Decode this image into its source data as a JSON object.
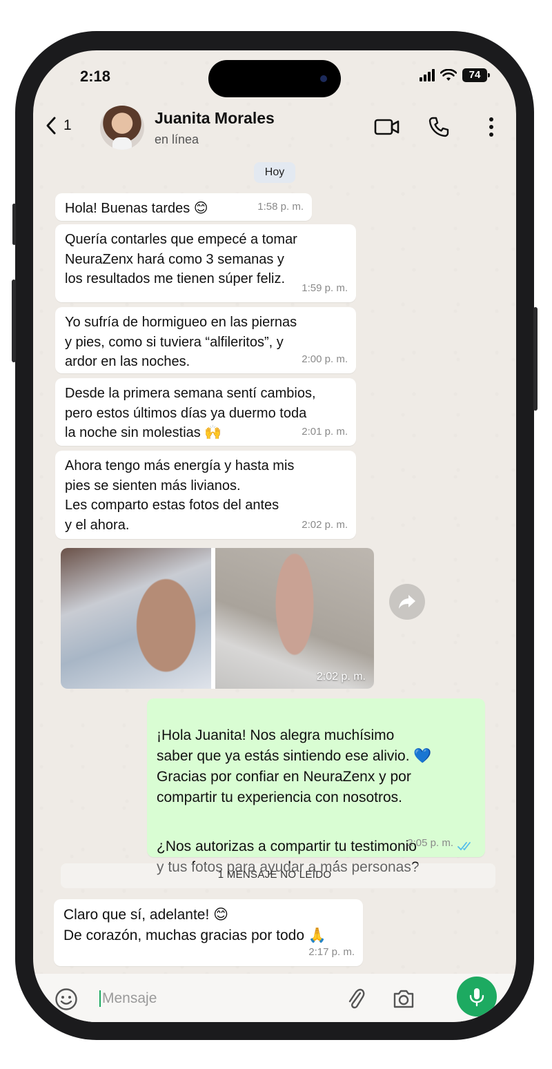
{
  "status_bar": {
    "time": "2:18",
    "battery": "74"
  },
  "header": {
    "back_count": "1",
    "contact_name": "Juanita Morales",
    "contact_status": "en línea"
  },
  "date_separator": "Hoy",
  "messages": [
    {
      "text": "Hola! Buenas tardes 😊",
      "time": "1:58 p. m."
    },
    {
      "text": "Quería contarles que empecé a tomar\nNeuraZenx hará como 3 semanas y\nlos resultados me tienen súper feliz.",
      "time": "1:59 p. m."
    },
    {
      "text": "Yo sufría de hormigueo en las piernas\ny pies, como si tuviera “alfileritos”, y\nardor en las noches.",
      "time": "2:00 p. m."
    },
    {
      "text": "Desde la primera semana sentí cambios,\npero estos últimos días ya duermo toda\nla noche sin molestias 🙌",
      "time": "2:01 p. m."
    },
    {
      "text": "Ahora tengo más energía y hasta mis\npies se sienten más livianos.\nLes comparto estas fotos del antes\ny el ahora.",
      "time": "2:02 p. m."
    }
  ],
  "photo_message": {
    "time": "2:02 p. m."
  },
  "outgoing": {
    "paragraph1": "¡Hola Juanita! Nos alegra muchísimo\nsaber que ya estás sintiendo ese alivio. 💙\nGracias por confiar en NeuraZenx y por\ncompartir tu experiencia con nosotros.",
    "paragraph2": "¿Nos autorizas a compartir tu testimonio\ny tus fotos para ayudar a más personas?",
    "time": "2:05 p. m."
  },
  "unread_banner": "1 MENSAJE NO LEÍDO",
  "last_message": {
    "text": "Claro que sí, adelante! 😊\nDe corazón, muchas gracias por todo 🙏",
    "time": "2:17 p. m."
  },
  "input": {
    "placeholder": "Mensaje"
  },
  "colors": {
    "outgoing_bubble": "#d9fdd3",
    "accent": "#1daa61",
    "read_ticks": "#53bdeb"
  },
  "icons": [
    "back-chevron-icon",
    "video-call-icon",
    "phone-call-icon",
    "more-options-icon",
    "forward-icon",
    "emoji-icon",
    "attach-icon",
    "camera-icon",
    "mic-icon",
    "read-ticks-icon",
    "signal-icon",
    "wifi-icon",
    "battery-icon"
  ]
}
